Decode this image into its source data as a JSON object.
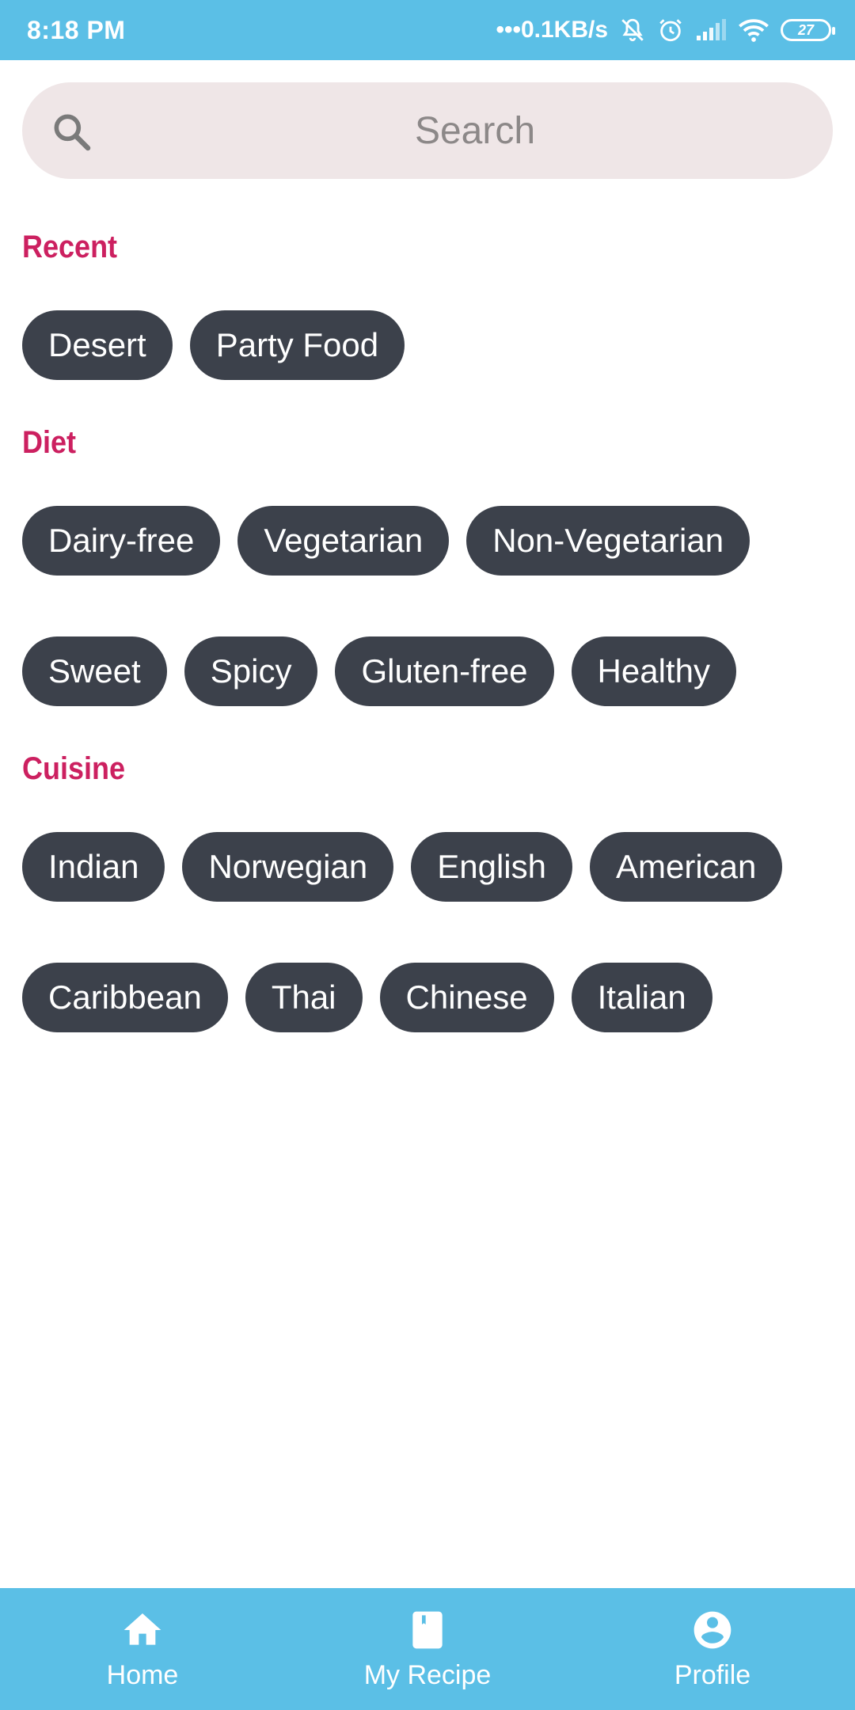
{
  "status_bar": {
    "time": "8:18 PM",
    "network_speed": "•••0.1KB/s",
    "battery_level": "27",
    "icons": [
      "mute-bell-icon",
      "alarm-icon",
      "signal-icon",
      "wifi-icon",
      "battery-icon"
    ]
  },
  "search": {
    "placeholder": "Search",
    "icon": "search-icon"
  },
  "sections": {
    "recent": {
      "title": "Recent",
      "chips": [
        "Desert",
        "Party Food"
      ]
    },
    "diet": {
      "title": "Diet",
      "row1": [
        "Dairy-free",
        "Vegetarian",
        "Non-Vegetarian"
      ],
      "row2": [
        "Sweet",
        "Spicy",
        "Gluten-free",
        "Healthy"
      ]
    },
    "cuisine": {
      "title": "Cuisine",
      "row1": [
        "Indian",
        "Norwegian",
        "English",
        "American"
      ],
      "row2": [
        "Caribbean",
        "Thai",
        "Chinese",
        "Italian"
      ]
    }
  },
  "bottom_nav": {
    "items": [
      {
        "label": "Home",
        "icon": "home-icon"
      },
      {
        "label": "My Recipe",
        "icon": "book-icon"
      },
      {
        "label": "Profile",
        "icon": "account-circle-icon"
      }
    ]
  },
  "colors": {
    "primary": "#5bbfe6",
    "accent": "#cc2060",
    "chip": "#3c414b",
    "search_bg": "#efe6e7"
  }
}
